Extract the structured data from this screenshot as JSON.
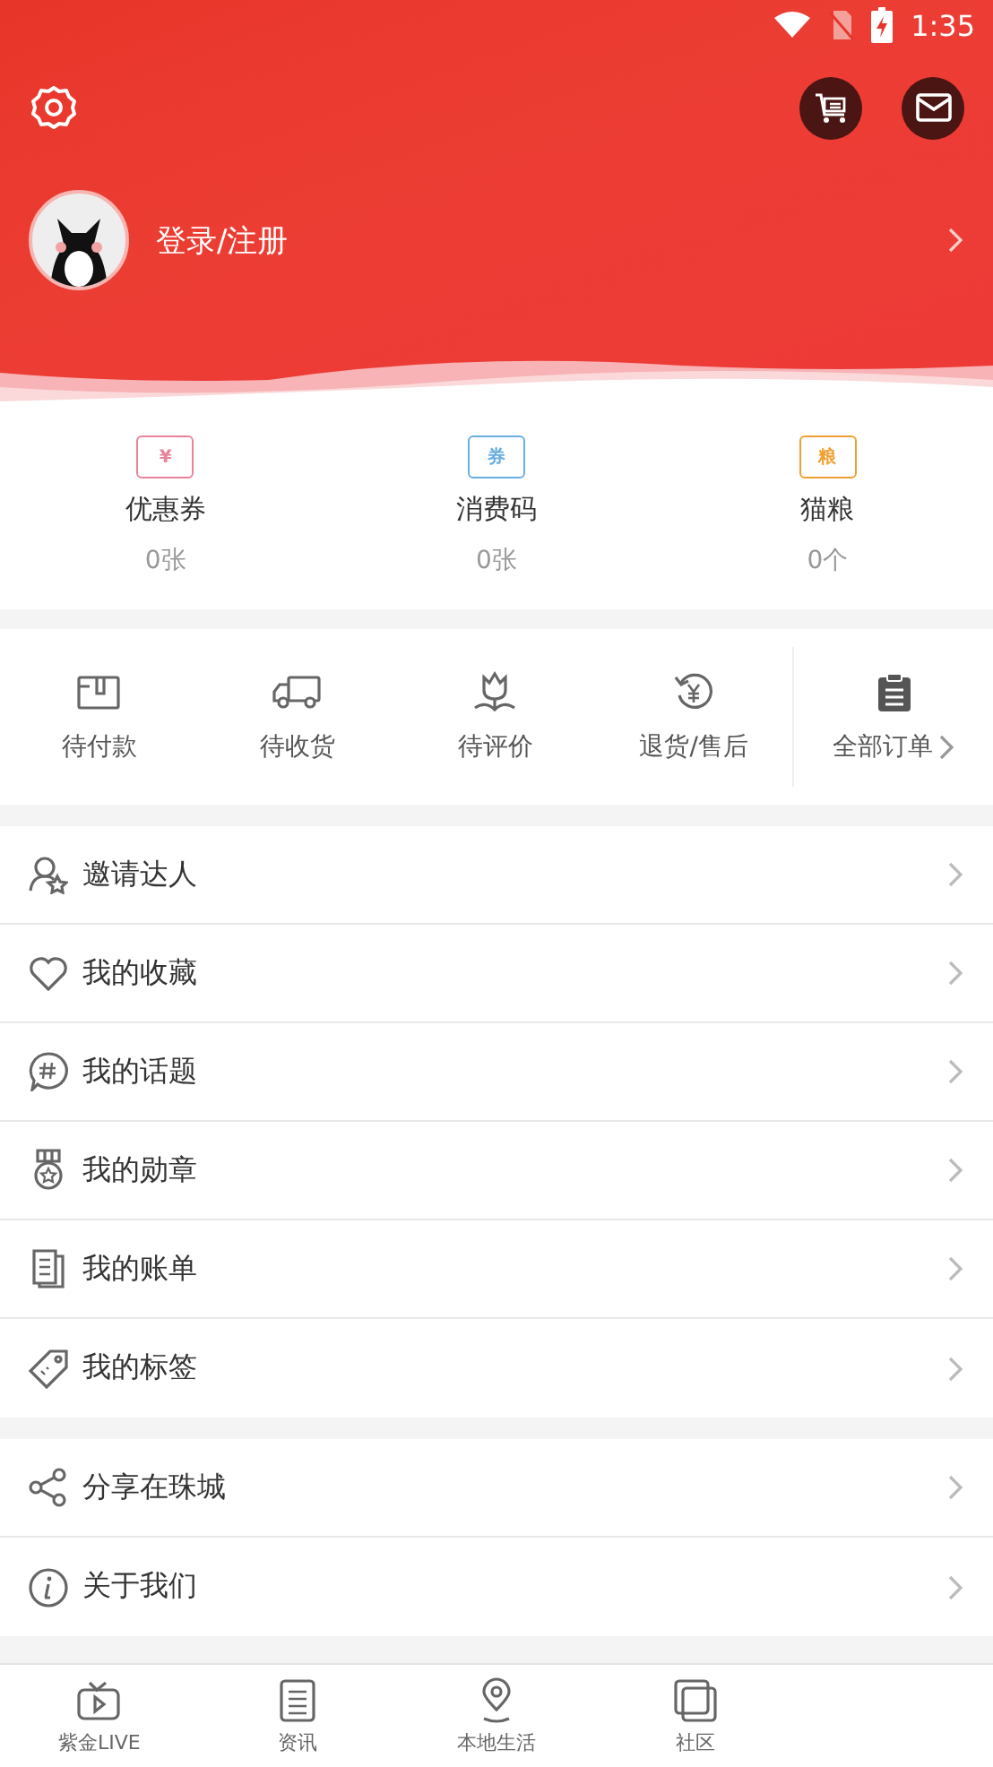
{
  "status_bar": {
    "time": "1:35"
  },
  "profile": {
    "login_label": "登录/注册"
  },
  "wallet": [
    {
      "label": "优惠券",
      "count": "0张"
    },
    {
      "label": "消费码",
      "count": "0张"
    },
    {
      "label": "猫粮",
      "count": "0个"
    }
  ],
  "wallet_badges": [
    "¥",
    "券",
    "粮"
  ],
  "orders": [
    {
      "label": "待付款"
    },
    {
      "label": "待收货"
    },
    {
      "label": "待评价"
    },
    {
      "label": "退货/售后"
    }
  ],
  "all_orders": {
    "label": "全部订单"
  },
  "menu_groups": [
    {
      "items": [
        {
          "label": "邀请达人"
        },
        {
          "label": "我的收藏"
        },
        {
          "label": "我的话题"
        },
        {
          "label": "我的勋章"
        },
        {
          "label": "我的账单"
        },
        {
          "label": "我的标签"
        }
      ]
    },
    {
      "items": [
        {
          "label": "分享在珠城"
        },
        {
          "label": "关于我们"
        }
      ]
    }
  ],
  "bottom_nav": [
    {
      "label": "紫金LIVE"
    },
    {
      "label": "资讯"
    },
    {
      "label": "本地生活"
    },
    {
      "label": "社区"
    }
  ]
}
